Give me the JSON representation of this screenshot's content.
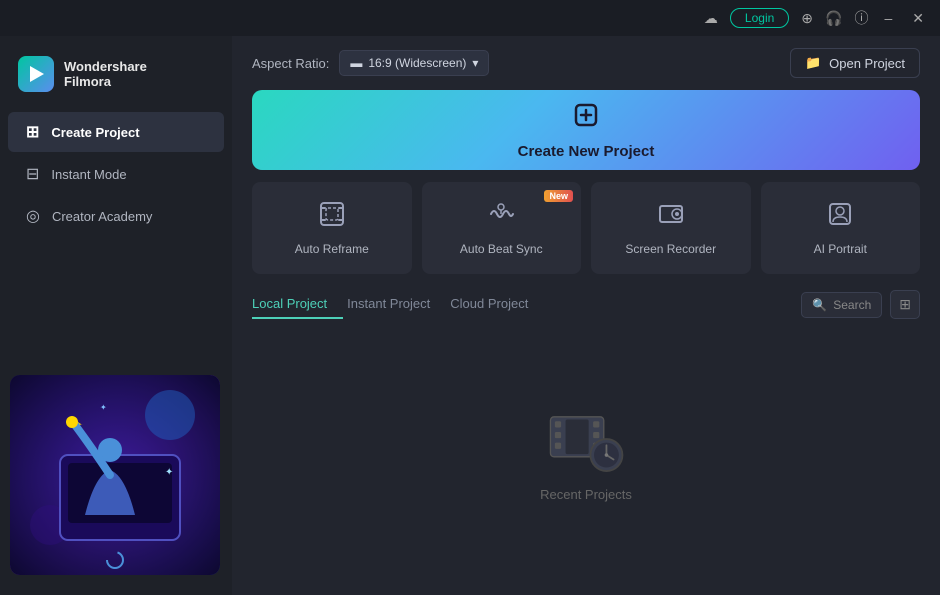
{
  "titlebar": {
    "login_label": "Login",
    "minimize_label": "–",
    "close_label": "✕"
  },
  "sidebar": {
    "logo_text1": "Wondershare",
    "logo_text2": "Filmora",
    "items": [
      {
        "id": "create-project",
        "label": "Create Project",
        "active": true
      },
      {
        "id": "instant-mode",
        "label": "Instant Mode",
        "active": false
      },
      {
        "id": "creator-academy",
        "label": "Creator Academy",
        "active": false
      }
    ]
  },
  "header": {
    "aspect_ratio_label": "Aspect Ratio:",
    "aspect_ratio_value": "16:9 (Widescreen)",
    "open_project_label": "Open Project"
  },
  "create_banner": {
    "label": "Create New Project"
  },
  "feature_cards": [
    {
      "id": "auto-reframe",
      "label": "Auto Reframe",
      "has_new": false
    },
    {
      "id": "auto-beat-sync",
      "label": "Auto Beat Sync",
      "has_new": true
    },
    {
      "id": "screen-recorder",
      "label": "Screen Recorder",
      "has_new": false
    },
    {
      "id": "ai-portrait",
      "label": "AI Portrait",
      "has_new": false
    }
  ],
  "badges": {
    "new": "New"
  },
  "project_tabs": {
    "tabs": [
      {
        "id": "local",
        "label": "Local Project",
        "active": true
      },
      {
        "id": "instant",
        "label": "Instant Project",
        "active": false
      },
      {
        "id": "cloud",
        "label": "Cloud Project",
        "active": false
      }
    ],
    "search_placeholder": "Search"
  },
  "empty_state": {
    "label": "Recent Projects"
  }
}
